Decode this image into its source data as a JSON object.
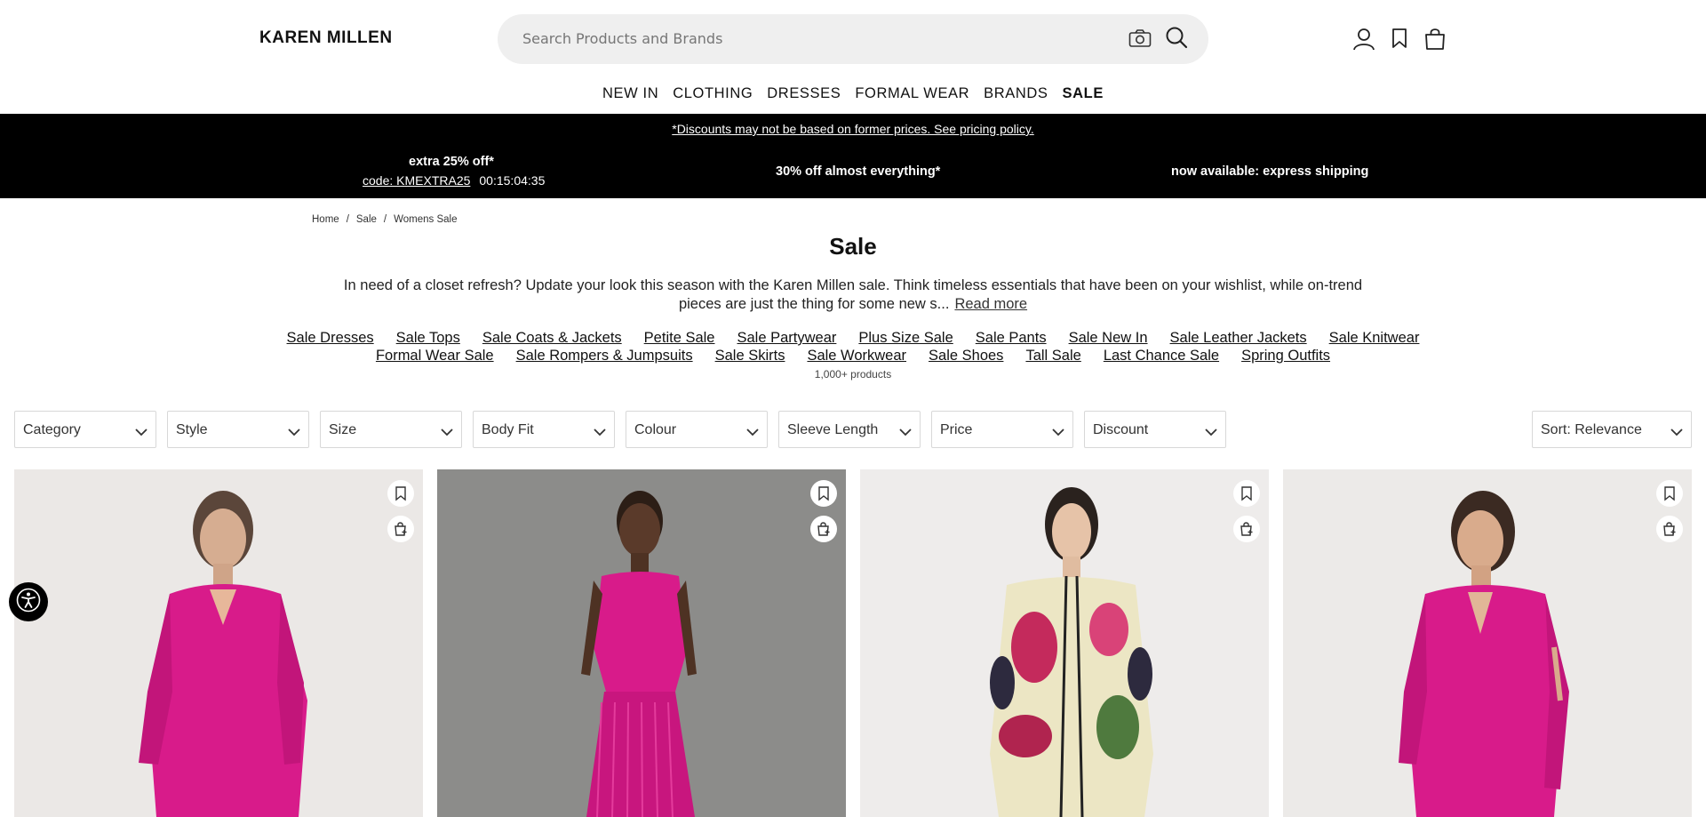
{
  "header": {
    "logo": "KAREN MILLEN",
    "search_placeholder": "Search Products and Brands",
    "icons": [
      "camera-icon",
      "search-icon",
      "account-icon",
      "wishlist-icon",
      "bag-icon"
    ]
  },
  "nav": {
    "items": [
      "NEW IN",
      "CLOTHING",
      "DRESSES",
      "FORMAL WEAR",
      "BRANDS",
      "SALE"
    ]
  },
  "promo": {
    "disclaimer": "*Discounts may not be based on former prices. See pricing policy.",
    "offer1_title": "extra 25% off*",
    "offer1_code": "code: KMEXTRA25",
    "offer1_timer": "00:15:04:35",
    "offer2": "30% off almost everything*",
    "offer3": "now available: express shipping"
  },
  "breadcrumb": [
    "Home",
    "Sale",
    "Womens Sale"
  ],
  "page": {
    "title": "Sale",
    "intro": "In need of a closet refresh? Update your look this season with the Karen Millen sale. Think timeless essentials that have been on your wishlist, while on-trend pieces are just the thing for some new s...",
    "read_more": "Read more",
    "product_count": "1,000+ products"
  },
  "categories_row1": [
    "Sale Dresses",
    "Sale Tops",
    "Sale Coats & Jackets",
    "Petite Sale",
    "Sale Partywear",
    "Plus Size Sale",
    "Sale Pants",
    "Sale New In",
    "Sale Leather Jackets",
    "Sale Knitwear"
  ],
  "categories_row2": [
    "Formal Wear Sale",
    "Sale Rompers & Jumpsuits",
    "Sale Skirts",
    "Sale Workwear",
    "Sale Shoes",
    "Tall Sale",
    "Last Chance Sale",
    "Spring Outfits"
  ],
  "filters": [
    "Category",
    "Style",
    "Size",
    "Body Fit",
    "Colour",
    "Sleeve Length",
    "Price",
    "Discount"
  ],
  "sort_label": "Sort: Relevance",
  "colors": {
    "promo_bg": "#000000",
    "product_pink": "#d81b8a",
    "search_bg": "#efefef"
  }
}
